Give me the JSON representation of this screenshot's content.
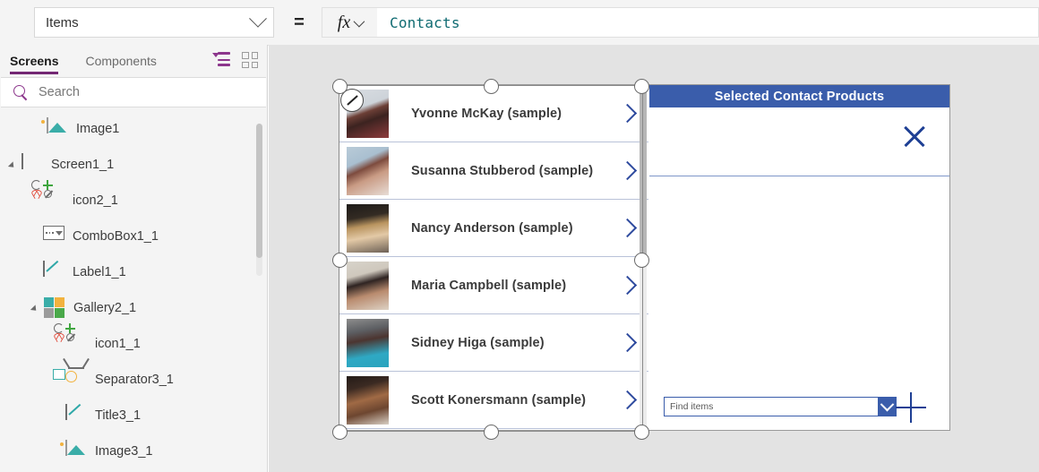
{
  "propertybar": {
    "property_value": "Items",
    "equals": "=",
    "fx_label": "fx",
    "formula_value": "Contacts"
  },
  "leftpanel": {
    "tabs": [
      {
        "label": "Screens",
        "active": true
      },
      {
        "label": "Components",
        "active": false
      }
    ],
    "view_icons": [
      "tree-view-icon",
      "tile-view-icon"
    ],
    "search": {
      "placeholder": "Search"
    },
    "tree": [
      {
        "label": "Image1",
        "icon": "image-icon",
        "indent": 2,
        "caret": false
      },
      {
        "label": "Screen1_1",
        "icon": "screen-icon",
        "indent": 0,
        "caret": true
      },
      {
        "label": "icon2_1",
        "icon": "icon-shape-icon",
        "indent": 1,
        "caret": false
      },
      {
        "label": "ComboBox1_1",
        "icon": "combobox-icon",
        "indent": 1,
        "caret": false
      },
      {
        "label": "Label1_1",
        "icon": "label-icon",
        "indent": 1,
        "caret": false
      },
      {
        "label": "Gallery2_1",
        "icon": "gallery-icon",
        "indent": 1,
        "caret": true
      },
      {
        "label": "icon1_1",
        "icon": "icon-shape-icon",
        "indent": 2,
        "caret": false
      },
      {
        "label": "Separator3_1",
        "icon": "separator-icon",
        "indent": 2,
        "caret": false
      },
      {
        "label": "Title3_1",
        "icon": "label-icon",
        "indent": 2,
        "caret": false
      },
      {
        "label": "Image3_1",
        "icon": "image-icon",
        "indent": 2,
        "caret": false
      }
    ]
  },
  "canvas": {
    "gallery": {
      "items": [
        {
          "name": "Yvonne McKay (sample)",
          "chevron": "chevron-right-icon"
        },
        {
          "name": "Susanna Stubberod (sample)",
          "chevron": "chevron-right-icon"
        },
        {
          "name": "Nancy Anderson (sample)",
          "chevron": "chevron-right-icon"
        },
        {
          "name": "Maria Campbell (sample)",
          "chevron": "chevron-right-icon"
        },
        {
          "name": "Sidney Higa (sample)",
          "chevron": "chevron-right-icon"
        },
        {
          "name": "Scott Konersmann (sample)",
          "chevron": "chevron-right-icon"
        }
      ]
    },
    "rightpane": {
      "header_title": "Selected Contact Products",
      "close_icon": "close-x-icon",
      "combo_placeholder": "Find items",
      "add_icon": "plus-icon"
    }
  },
  "colors": {
    "accent_purple": "#742774",
    "header_blue": "#3a5dab",
    "chevron_blue": "#2e4a9e",
    "formula_teal": "#0f6b72",
    "canvas_bg": "#e3e3e3"
  }
}
